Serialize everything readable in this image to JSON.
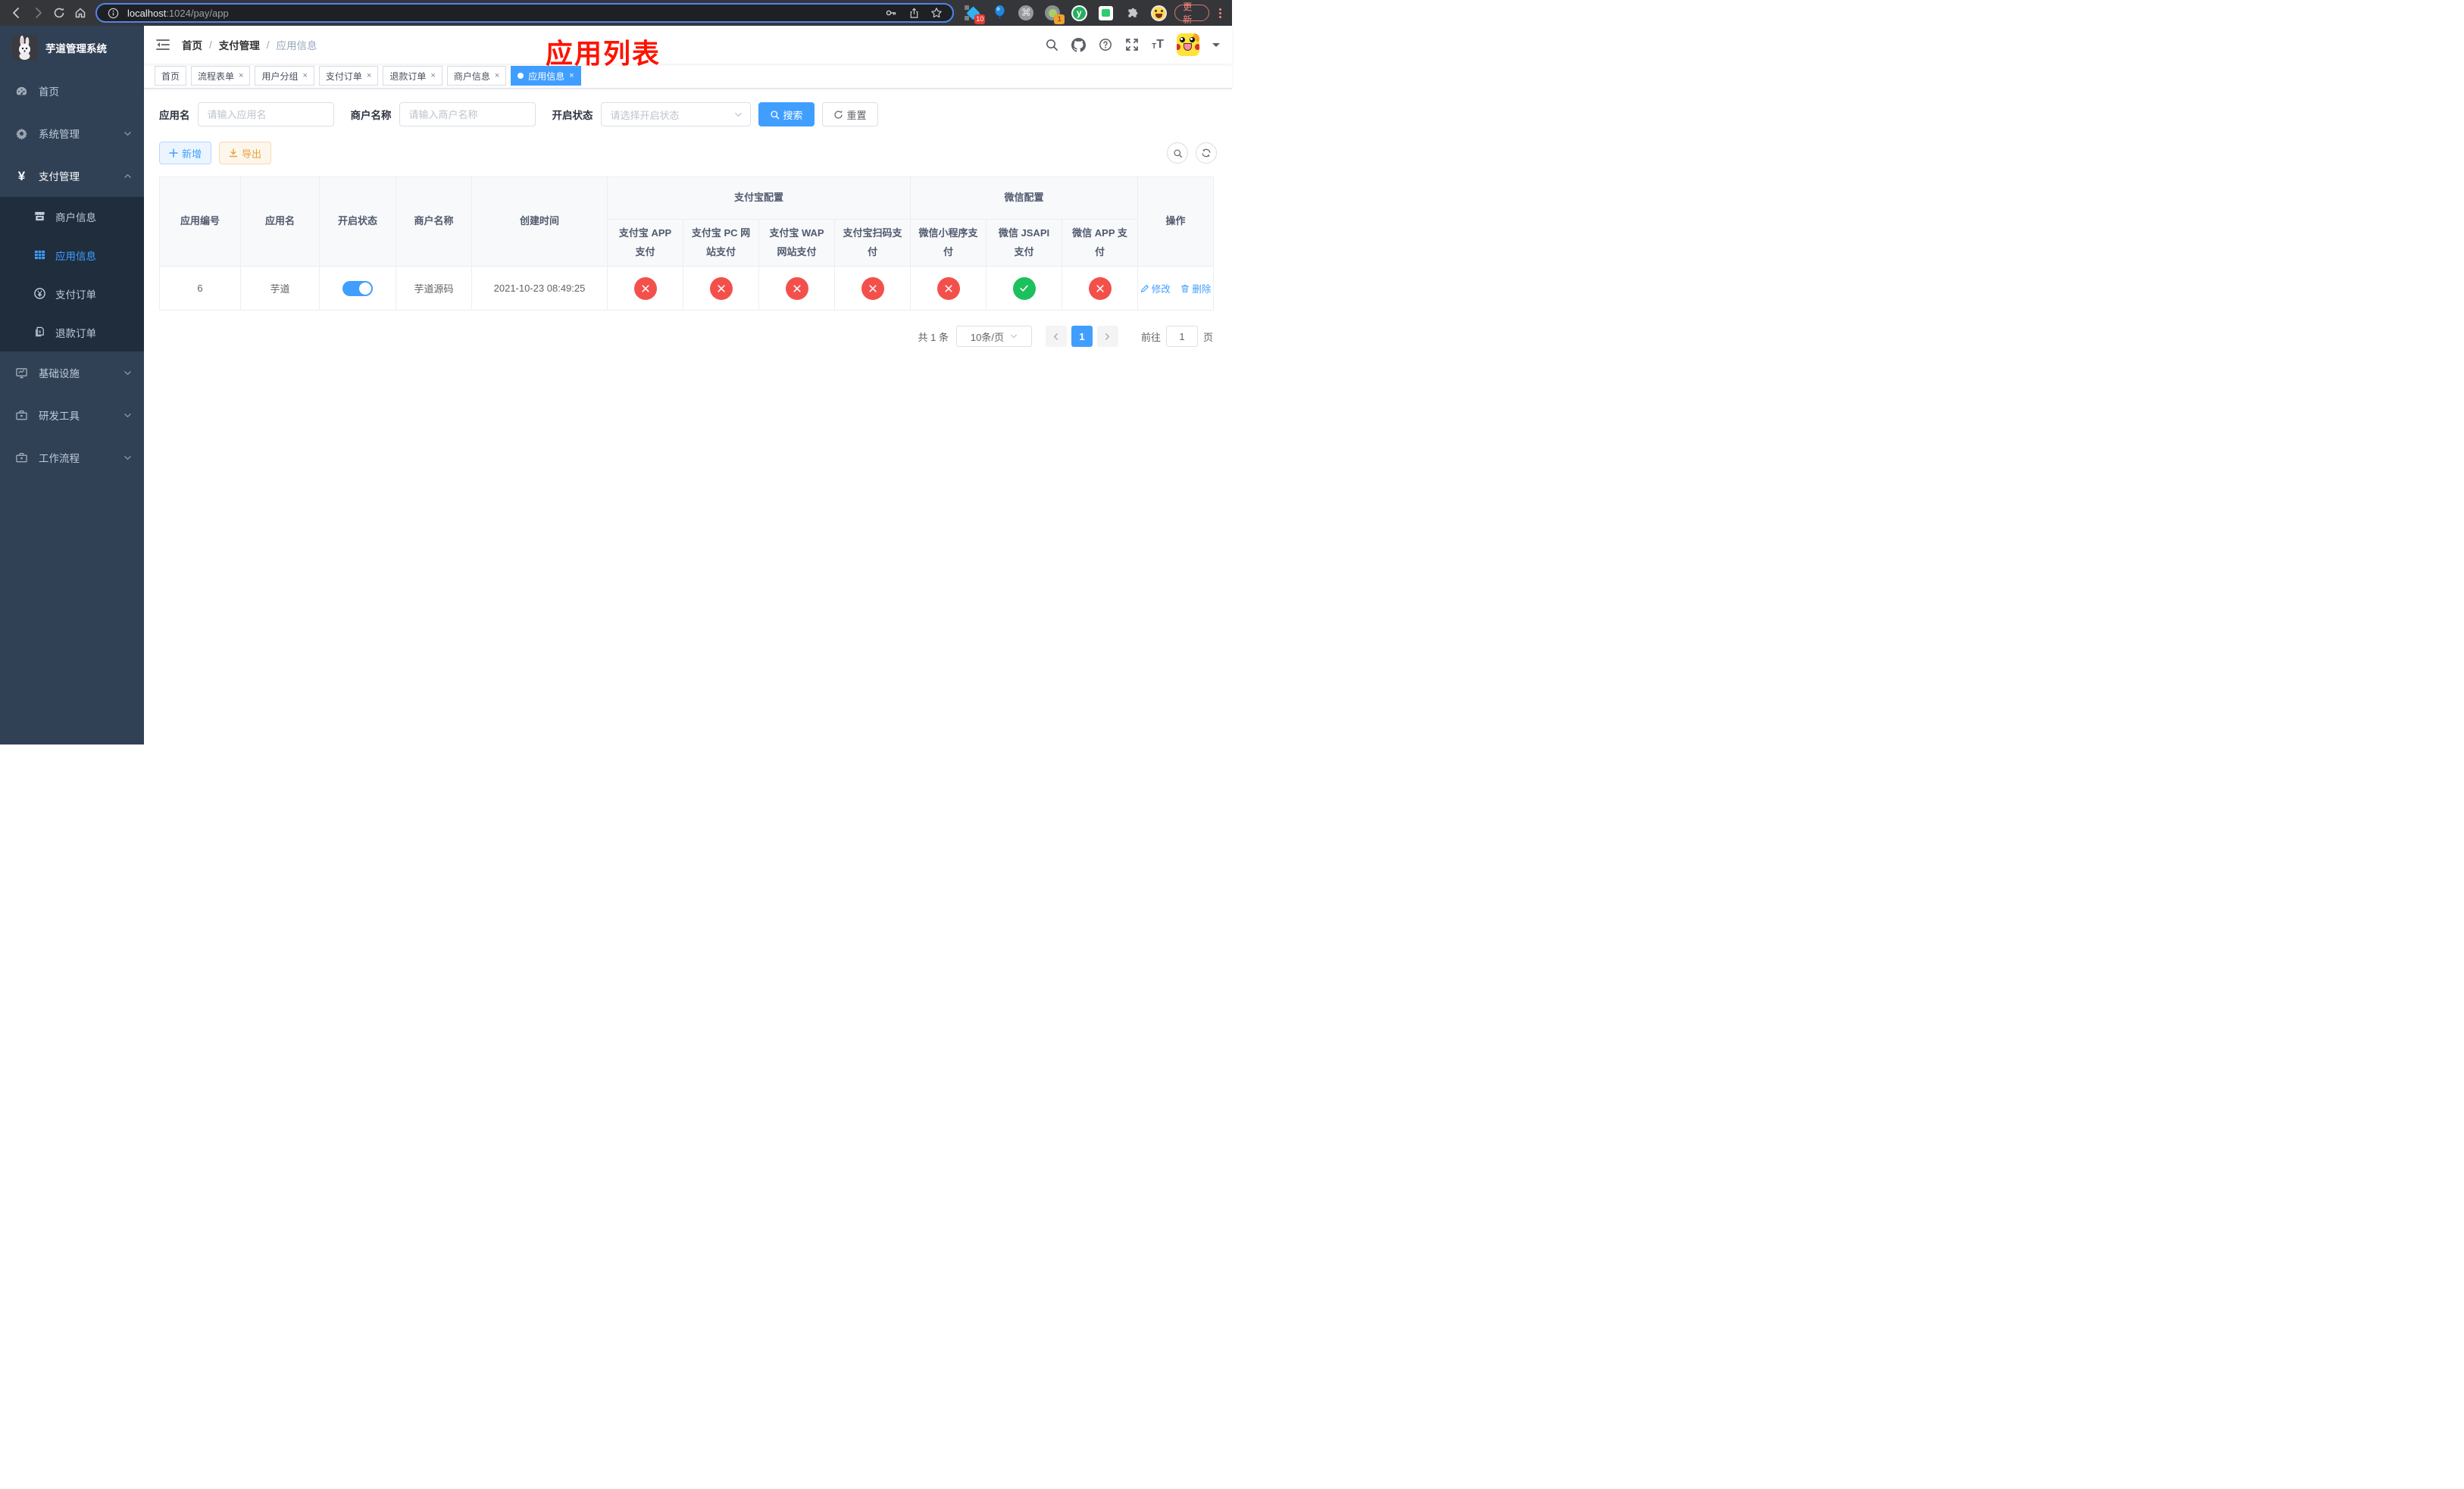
{
  "browser": {
    "url": {
      "host": "localhost",
      "rest": ":1024/pay/app"
    },
    "extensions": {
      "badge_blue": "10",
      "badge_orange": "1",
      "letter_y": "y"
    },
    "update_button": "更新"
  },
  "sidebar": {
    "title": "芋道管理系统",
    "menu": [
      {
        "label": "首页"
      },
      {
        "label": "系统管理"
      },
      {
        "label": "支付管理"
      }
    ],
    "submenu": [
      {
        "label": "商户信息"
      },
      {
        "label": "应用信息"
      },
      {
        "label": "支付订单"
      },
      {
        "label": "退款订单"
      }
    ],
    "menu2": [
      {
        "label": "基础设施"
      },
      {
        "label": "研发工具"
      },
      {
        "label": "工作流程"
      }
    ]
  },
  "navbar": {
    "breadcrumb": [
      "首页",
      "支付管理",
      "应用信息"
    ],
    "annotation": "应用列表"
  },
  "tabs": [
    {
      "label": "首页"
    },
    {
      "label": "流程表单"
    },
    {
      "label": "用户分组"
    },
    {
      "label": "支付订单"
    },
    {
      "label": "退款订单"
    },
    {
      "label": "商户信息"
    },
    {
      "label": "应用信息"
    }
  ],
  "icons": {
    "close": "×",
    "yen": "¥",
    "command": "⌘"
  },
  "search": {
    "app_name_label": "应用名",
    "app_name_placeholder": "请输入应用名",
    "merchant_label": "商户名称",
    "merchant_placeholder": "请输入商户名称",
    "status_label": "开启状态",
    "status_placeholder": "请选择开启状态",
    "search_button": "搜索",
    "reset_button": "重置"
  },
  "toolbar": {
    "add_button": "新增",
    "export_button": "导出"
  },
  "table": {
    "headers_main": [
      "应用编号",
      "应用名",
      "开启状态",
      "商户名称",
      "创建时间"
    ],
    "group_alipay": "支付宝配置",
    "group_wechat": "微信配置",
    "headers_alipay": [
      "支付宝 APP 支付",
      "支付宝 PC 网站支付",
      "支付宝 WAP 网站支付",
      "支付宝扫码支付"
    ],
    "headers_wechat": [
      "微信小程序支付",
      "微信 JSAPI 支付",
      "微信 APP 支付"
    ],
    "header_actions": "操作",
    "row": {
      "id": "6",
      "name": "芋道",
      "enabled": true,
      "merchant": "芋道源码",
      "created": "2021-10-23 08:49:25",
      "statuses": [
        "fail",
        "fail",
        "fail",
        "fail",
        "fail",
        "success",
        "fail"
      ],
      "edit_label": "修改",
      "delete_label": "删除"
    }
  },
  "pagination": {
    "total": "共 1 条",
    "page_size": "10条/页",
    "current_page": "1",
    "goto_prefix": "前往",
    "goto_value": "1",
    "goto_suffix": "页"
  },
  "colors": {
    "primary": "#409eff",
    "success": "#1cc05c",
    "danger": "#f4504b",
    "warning": "#e6a23c",
    "sidebar_bg": "#304156",
    "submenu_bg": "#1f2d3d",
    "annotation_red": "#ff1200"
  }
}
